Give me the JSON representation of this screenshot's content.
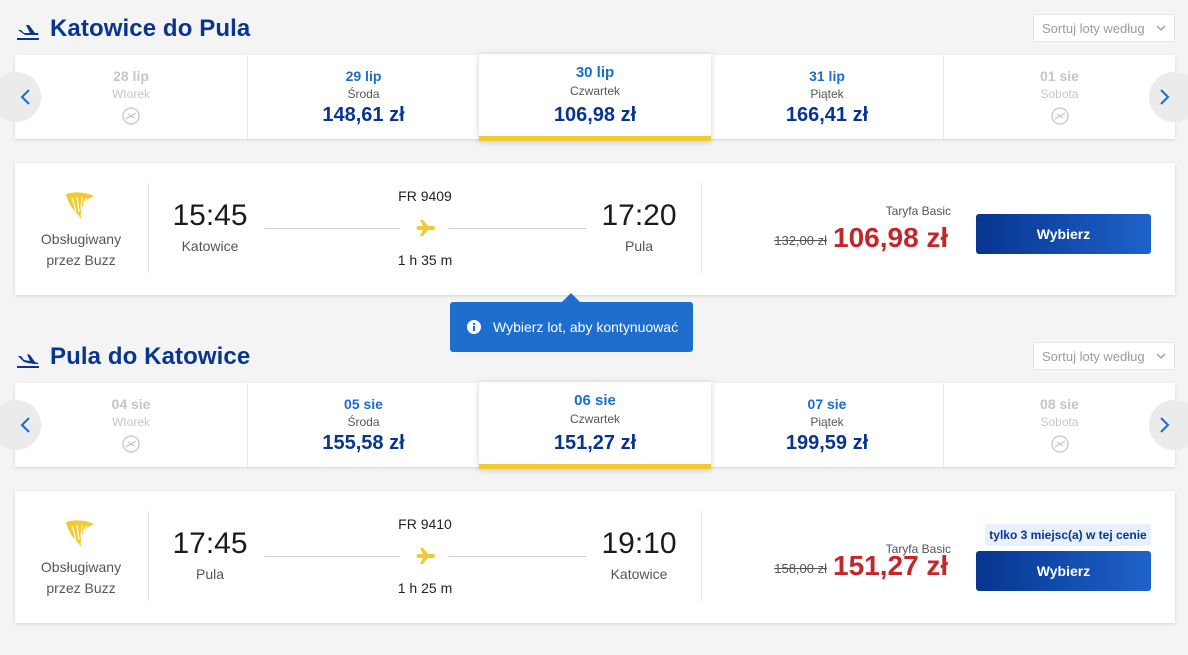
{
  "outbound": {
    "title": "Katowice do Pula",
    "sort_placeholder": "Sortuj loty według",
    "dates": [
      {
        "date": "28 lip",
        "weekday": "Wtorek",
        "price": "",
        "available": false
      },
      {
        "date": "29 lip",
        "weekday": "Środa",
        "price": "148,61 zł",
        "available": true
      },
      {
        "date": "30 lip",
        "weekday": "Czwartek",
        "price": "106,98 zł",
        "available": true,
        "selected": true
      },
      {
        "date": "31 lip",
        "weekday": "Piątek",
        "price": "166,41 zł",
        "available": true
      },
      {
        "date": "01 sie",
        "weekday": "Sobota",
        "price": "",
        "available": false
      }
    ],
    "flight": {
      "operated_by": "Obsługiwany przez Buzz",
      "departure_time": "15:45",
      "departure_city": "Katowice",
      "flight_number": "FR 9409",
      "duration": "1 h 35 m",
      "arrival_time": "17:20",
      "arrival_city": "Pula",
      "fare_type": "Taryfa Basic",
      "old_price": "132,00 zł",
      "price": "106,98 zł",
      "select_label": "Wybierz"
    }
  },
  "tooltip": {
    "icon": "info-icon",
    "message": "Wybierz lot, aby kontynuować"
  },
  "inbound": {
    "title": "Pula do Katowice",
    "sort_placeholder": "Sortuj loty według",
    "dates": [
      {
        "date": "04 sie",
        "weekday": "Wtorek",
        "price": "",
        "available": false
      },
      {
        "date": "05 sie",
        "weekday": "Środa",
        "price": "155,58 zł",
        "available": true
      },
      {
        "date": "06 sie",
        "weekday": "Czwartek",
        "price": "151,27 zł",
        "available": true,
        "selected": true
      },
      {
        "date": "07 sie",
        "weekday": "Piątek",
        "price": "199,59 zł",
        "available": true
      },
      {
        "date": "08 sie",
        "weekday": "Sobota",
        "price": "",
        "available": false
      }
    ],
    "flight": {
      "operated_by": "Obsługiwany przez Buzz",
      "departure_time": "17:45",
      "departure_city": "Pula",
      "flight_number": "FR 9410",
      "duration": "1 h 25 m",
      "arrival_time": "19:10",
      "arrival_city": "Katowice",
      "seats_badge": "tylko 3 miejsc(a) w tej cenie",
      "fare_type": "Taryfa Basic",
      "old_price": "158,00 zł",
      "price": "151,27 zł",
      "select_label": "Wybierz"
    }
  },
  "colors": {
    "brand_blue": "#073590",
    "price_red": "#c3272b",
    "accent_yellow": "#f1c933",
    "tooltip_blue": "#1e6fcd"
  }
}
